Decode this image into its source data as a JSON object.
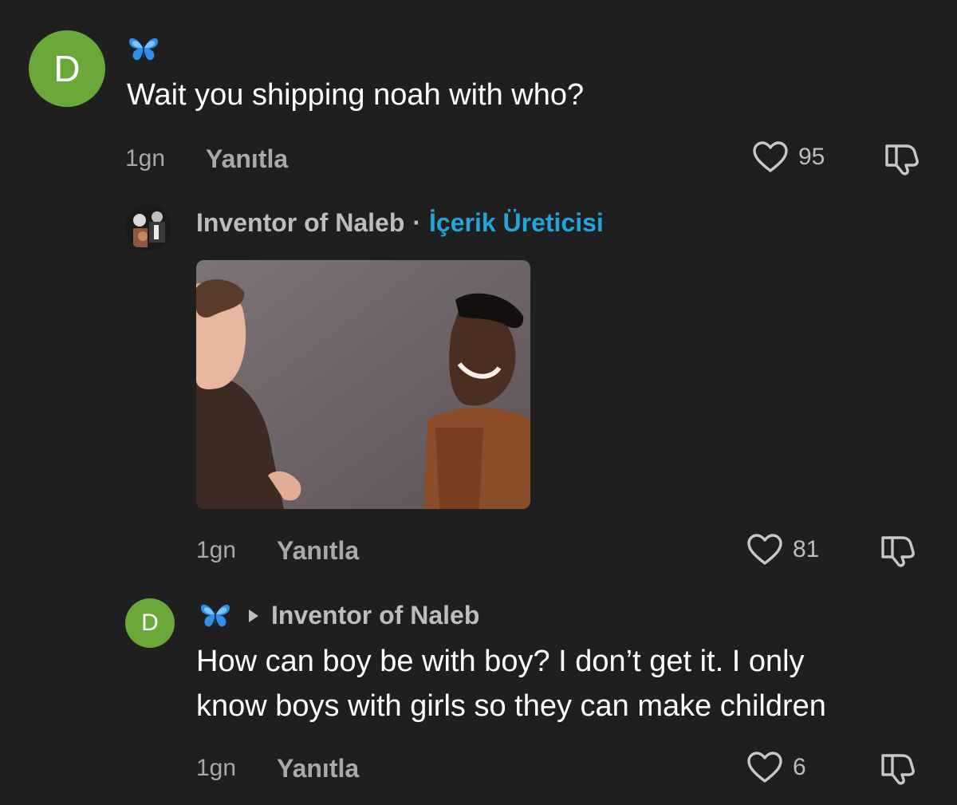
{
  "comments": [
    {
      "avatar_letter": "D",
      "username_emoji": "butterfly-emoji",
      "text": "Wait you shipping noah with who?",
      "time": "1gn",
      "reply_label": "Yanıtla",
      "likes": "95"
    },
    {
      "author": "Inventor of Naleb",
      "separator": "·",
      "badge": "İçerik Üreticisi",
      "media": "photo of two smiling men facing each other",
      "time": "1gn",
      "reply_label": "Yanıtla",
      "likes": "81"
    },
    {
      "avatar_letter": "D",
      "username_emoji": "butterfly-emoji",
      "reply_to": "Inventor of Naleb",
      "text_line1": "How can boy be with boy? I don’t get it. I only",
      "text_line2": "know boys with girls so they can make children",
      "time": "1gn",
      "reply_label": "Yanıtla",
      "likes": "6"
    }
  ],
  "colors": {
    "background": "#1f1f1f",
    "avatar_green": "#6aa83a",
    "creator_blue": "#20a6d9",
    "muted_text": "#a9a9a9"
  }
}
